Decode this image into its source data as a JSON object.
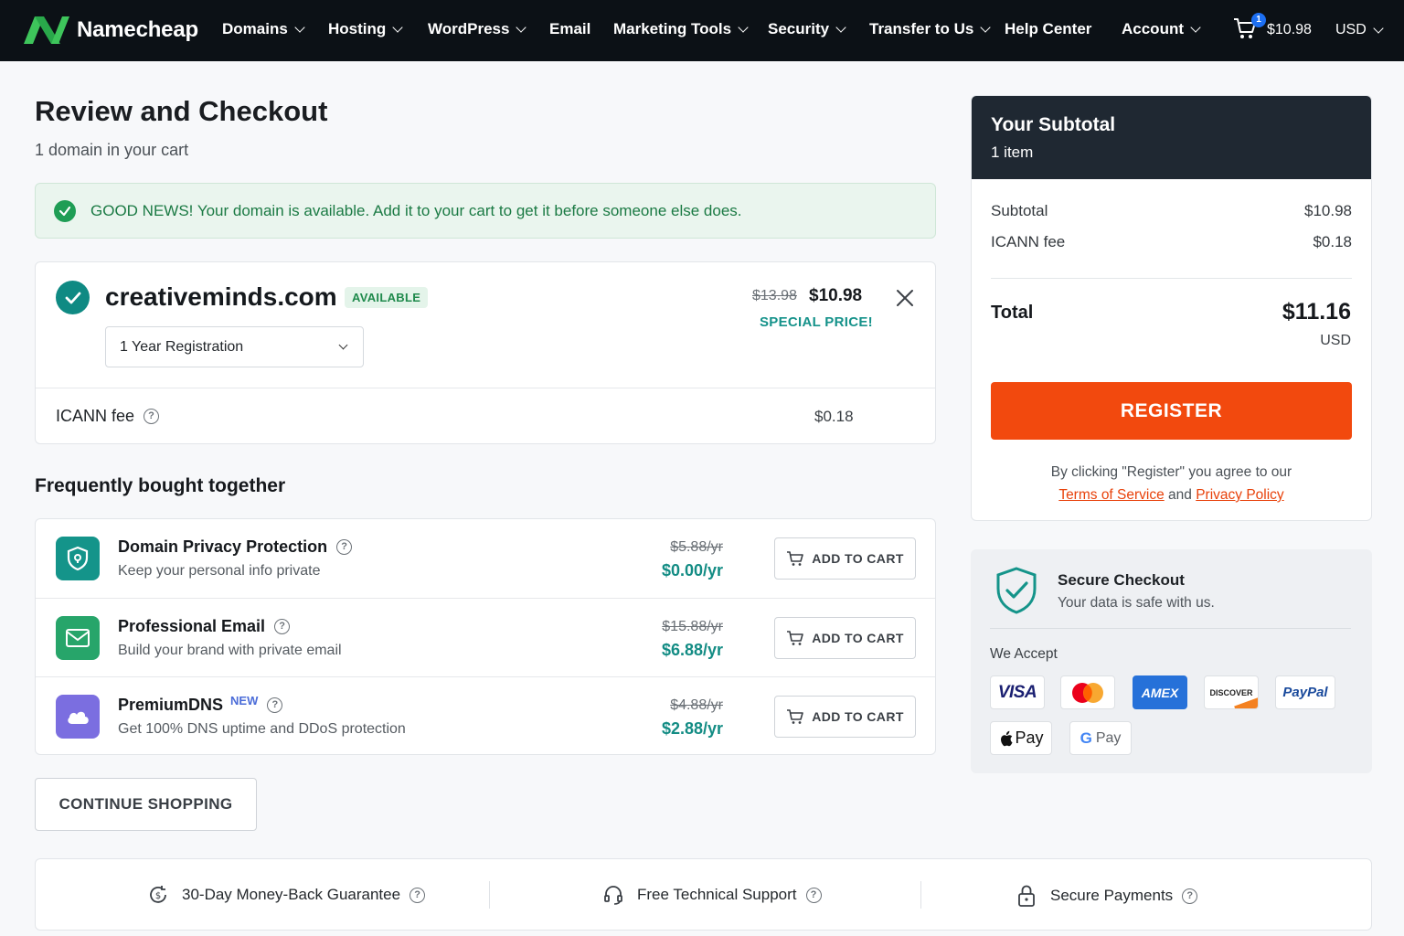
{
  "nav": {
    "brand": "Namecheap",
    "items": [
      "Domains",
      "Hosting",
      "WordPress",
      "Email",
      "Marketing Tools",
      "Security",
      "Transfer to Us",
      "Help Center",
      "Account"
    ],
    "cart_count": "1",
    "cart_total": "$10.98",
    "currency": "USD"
  },
  "page": {
    "title": "Review and Checkout",
    "subtitle": "1 domain in your cart"
  },
  "alert": {
    "strong": "GOOD NEWS!",
    "text": " Your domain is available. Add it to your cart to get it before someone else does."
  },
  "domain": {
    "name": "creativeminds.com",
    "badge": "AVAILABLE",
    "term": "1 Year Registration",
    "old_price": "$13.98",
    "price": "$10.98",
    "special": "SPECIAL PRICE!",
    "icann_label": "ICANN fee",
    "icann_value": "$0.18"
  },
  "fbt": {
    "title": "Frequently bought together",
    "add_label": "ADD TO CART",
    "items": [
      {
        "name": "Domain Privacy Protection",
        "desc": "Keep your personal info private",
        "old": "$5.88/yr",
        "price": "$0.00/yr",
        "icon": "shield-icon",
        "color": "#14948a"
      },
      {
        "name": "Professional Email",
        "desc": "Build your brand with private email",
        "old": "$15.88/yr",
        "price": "$6.88/yr",
        "icon": "mail-icon",
        "color": "#27a56a"
      },
      {
        "name": "PremiumDNS",
        "tag": "NEW",
        "desc": "Get 100% DNS uptime and DDoS protection",
        "old": "$4.88/yr",
        "price": "$2.88/yr",
        "icon": "cloud-icon",
        "color": "#7b6ee0"
      }
    ]
  },
  "continue_label": "CONTINUE SHOPPING",
  "guarantees": [
    "30-Day Money-Back Guarantee",
    "Free Technical Support",
    "Secure Payments"
  ],
  "summary": {
    "title": "Your Subtotal",
    "items": "1 item",
    "subtotal_label": "Subtotal",
    "subtotal": "$10.98",
    "icann_label": "ICANN fee",
    "icann": "$0.18",
    "total_label": "Total",
    "total": "$11.16",
    "currency": "USD",
    "register": "REGISTER",
    "agree_prefix": "By clicking \"Register\" you agree to our",
    "terms": "Terms of Service",
    "and": " and ",
    "privacy": "Privacy Policy"
  },
  "secure": {
    "title": "Secure Checkout",
    "sub": "Your data is safe with us.",
    "accept": "We Accept",
    "methods": [
      "VISA",
      "Mastercard",
      "AMEX",
      "DISCOVER",
      "PayPal",
      "Pay",
      "Pay"
    ]
  },
  "colors": {
    "accent": "#f2490e",
    "teal": "#14948a",
    "nav_bg": "#0c1116"
  }
}
